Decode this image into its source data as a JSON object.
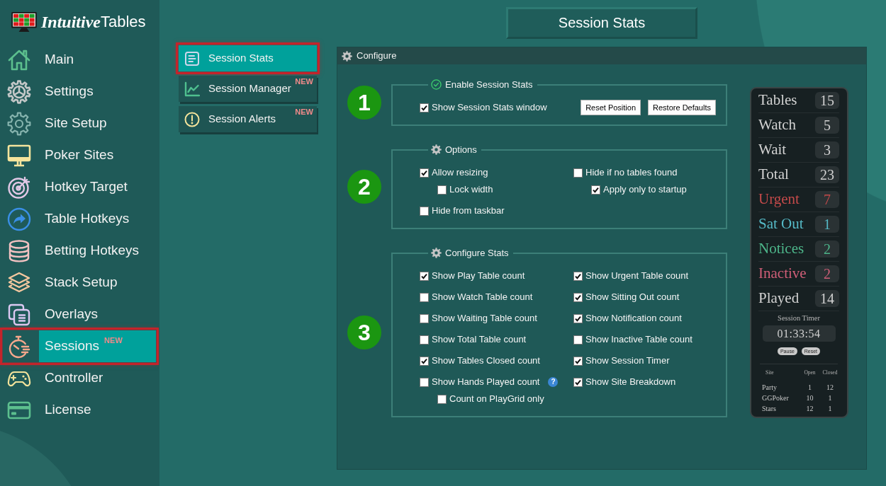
{
  "logo": {
    "parts": [
      "Intuitive",
      "Tables"
    ]
  },
  "sidebar": {
    "items": [
      {
        "label": "Main",
        "selected": false
      },
      {
        "label": "Settings",
        "selected": false
      },
      {
        "label": "Site Setup",
        "selected": false
      },
      {
        "label": "Poker Sites",
        "selected": false
      },
      {
        "label": "Hotkey Target",
        "selected": false
      },
      {
        "label": "Table Hotkeys",
        "selected": false
      },
      {
        "label": "Betting Hotkeys",
        "selected": false
      },
      {
        "label": "Stack Setup",
        "selected": false
      },
      {
        "label": "Overlays",
        "selected": false
      },
      {
        "label": "Sessions",
        "selected": true,
        "badge": "NEW"
      },
      {
        "label": "Controller",
        "selected": false
      },
      {
        "label": "License",
        "selected": false
      }
    ]
  },
  "subnav": {
    "items": [
      {
        "label": "Session Stats",
        "selected": true
      },
      {
        "label": "Session Manager",
        "selected": false,
        "badge": "NEW"
      },
      {
        "label": "Session Alerts",
        "selected": false,
        "badge": "NEW"
      }
    ]
  },
  "title": "Session Stats",
  "panel": {
    "title": "Configure",
    "groups": [
      {
        "number": "1",
        "legend": "Enable Session Stats",
        "columns": [
          [
            {
              "label": "Show Session Stats window",
              "checked": true
            }
          ]
        ],
        "buttons": [
          "Reset Position",
          "Restore Defaults"
        ]
      },
      {
        "number": "2",
        "legend": "Options",
        "columns": [
          [
            {
              "label": "Allow resizing",
              "checked": true,
              "children": [
                {
                  "label": "Lock width",
                  "checked": false
                }
              ]
            },
            {
              "label": "Hide from taskbar",
              "checked": false
            }
          ],
          [
            {
              "label": "Hide if no tables found",
              "checked": false,
              "children": [
                {
                  "label": "Apply only to startup",
                  "checked": true
                }
              ]
            }
          ]
        ]
      },
      {
        "number": "3",
        "legend": "Configure Stats",
        "columns": [
          [
            {
              "label": "Show Play Table count",
              "checked": true
            },
            {
              "label": "Show Watch Table count",
              "checked": false
            },
            {
              "label": "Show Waiting Table count",
              "checked": false
            },
            {
              "label": "Show Total Table count",
              "checked": false
            },
            {
              "label": "Show Tables Closed count",
              "checked": true
            },
            {
              "label": "Show Hands Played count",
              "checked": false,
              "help": "?",
              "children": [
                {
                  "label": "Count on PlayGrid only",
                  "checked": false
                }
              ]
            }
          ],
          [
            {
              "label": "Show Urgent Table count",
              "checked": true
            },
            {
              "label": "Show Sitting Out count",
              "checked": true
            },
            {
              "label": "Show Notification count",
              "checked": true
            },
            {
              "label": "Show Inactive Table count",
              "checked": false
            },
            {
              "label": "Show Session Timer",
              "checked": true
            },
            {
              "label": "Show Site Breakdown",
              "checked": true
            }
          ]
        ]
      }
    ]
  },
  "stats_window": {
    "rows": [
      {
        "label": "Tables",
        "value": "15",
        "color": "#d2d2d2"
      },
      {
        "label": "Watch",
        "value": "5",
        "color": "#d2d2d2"
      },
      {
        "label": "Wait",
        "value": "3",
        "color": "#d2d2d2"
      },
      {
        "label": "Total",
        "value": "23",
        "color": "#d2d2d2"
      },
      {
        "label": "Urgent",
        "value": "7",
        "color": "#c44a4a"
      },
      {
        "label": "Sat Out",
        "value": "1",
        "color": "#55b9c6"
      },
      {
        "label": "Notices",
        "value": "2",
        "color": "#4db58a"
      },
      {
        "label": "Inactive",
        "value": "2",
        "color": "#cf5e77"
      },
      {
        "label": "Played",
        "value": "14",
        "color": "#d2d2d2"
      }
    ],
    "timer_label": "Session Timer",
    "timer": "01:33:54",
    "buttons": [
      "Pause",
      "Reset"
    ],
    "site_table": {
      "columns": [
        "Site",
        "Open",
        "Closed"
      ],
      "rows": [
        [
          "Party",
          "1",
          "12"
        ],
        [
          "GGPoker",
          "10",
          "1"
        ],
        [
          "Stars",
          "12",
          "1"
        ]
      ]
    }
  }
}
